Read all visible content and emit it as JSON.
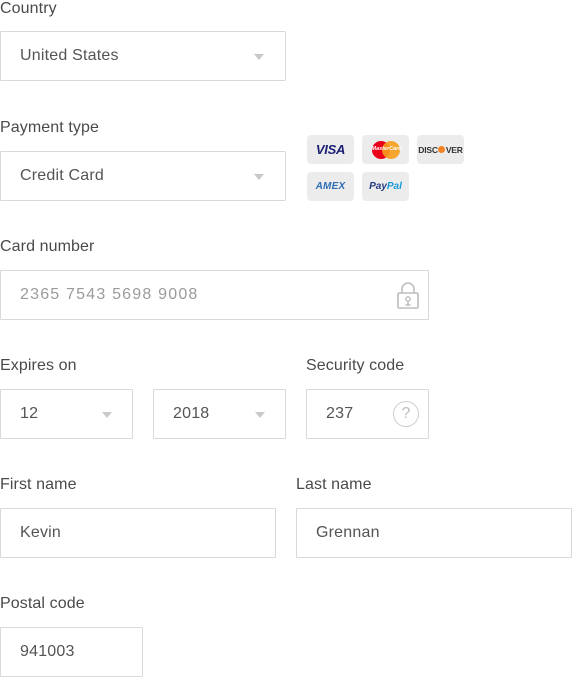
{
  "country": {
    "label": "Country",
    "value": "United States"
  },
  "payment_type": {
    "label": "Payment type",
    "value": "Credit Card",
    "cards": [
      "visa-logo",
      "mastercard-logo",
      "discover-logo",
      "amex-logo",
      "paypal-logo"
    ],
    "visa_text": "VISA",
    "mastercard_text": "MasterCard",
    "discover_text_a": "DISC",
    "discover_text_b": "VER",
    "amex_text": "AMEX",
    "paypal_text_a": "Pay",
    "paypal_text_b": "Pal"
  },
  "card_number": {
    "label": "Card number",
    "placeholder": "2365 7543 5698 9008",
    "icon": "lock-icon"
  },
  "expires": {
    "label": "Expires on",
    "month": "12",
    "year": "2018"
  },
  "security_code": {
    "label": "Security code",
    "value": "237",
    "help_icon": "?"
  },
  "first_name": {
    "label": "First name",
    "value": "Kevin"
  },
  "last_name": {
    "label": "Last name",
    "value": "Grennan"
  },
  "postal_code": {
    "label": "Postal code",
    "value": "941003"
  },
  "colors": {
    "border": "#d9d9d9",
    "text": "#545454",
    "placeholder": "#9b9b9b",
    "caret": "#c9c9c9"
  }
}
